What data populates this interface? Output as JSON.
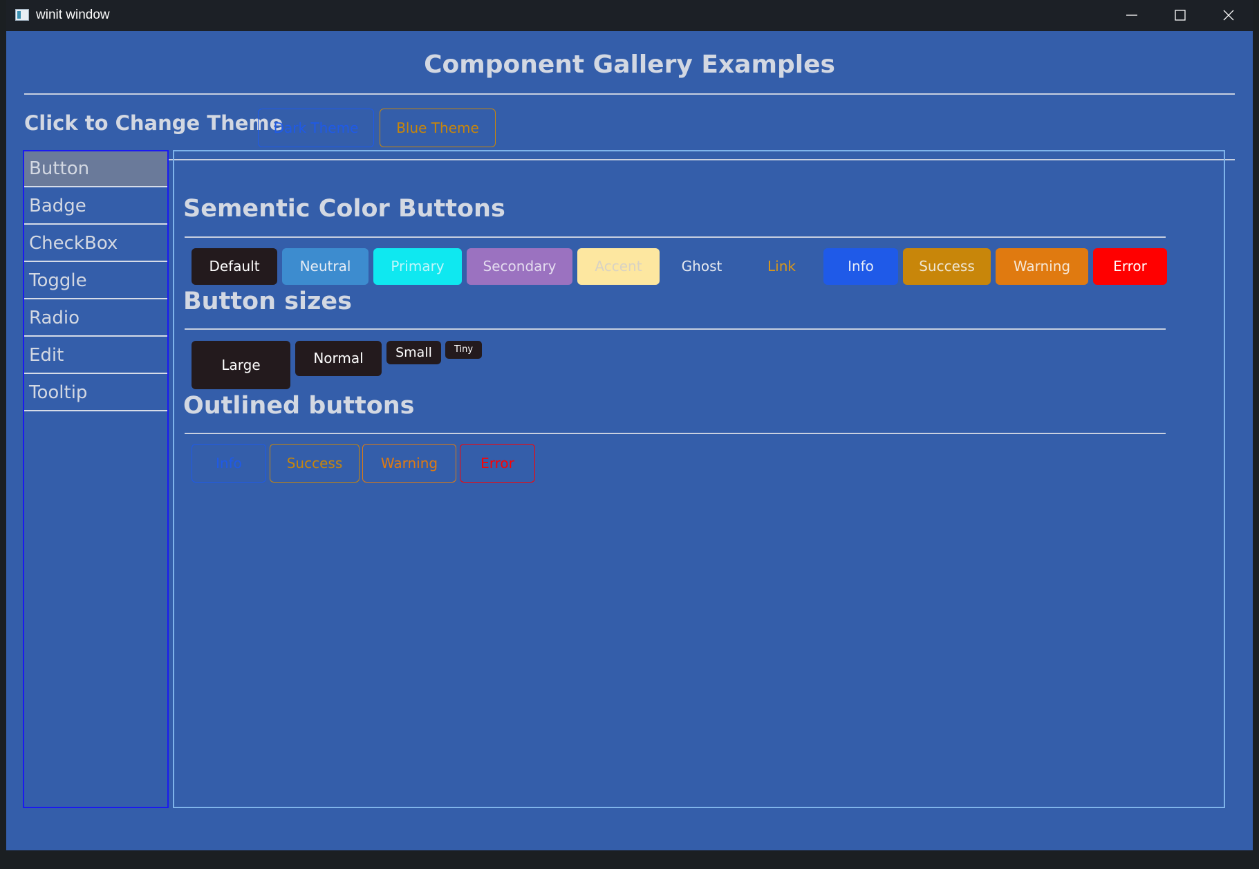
{
  "window": {
    "title": "winit window",
    "controls": {
      "minimize": "minimize",
      "maximize": "maximize",
      "close": "close"
    }
  },
  "app": {
    "title": "Component Gallery Examples",
    "theme_label": "Click to Change Theme",
    "theme_buttons": [
      {
        "label": "Dark Theme",
        "color": "#1f5ae8"
      },
      {
        "label": "Blue Theme",
        "color": "#c8860a"
      }
    ]
  },
  "sidebar": {
    "items": [
      {
        "label": "Button",
        "active": true
      },
      {
        "label": "Badge"
      },
      {
        "label": "CheckBox"
      },
      {
        "label": "Toggle"
      },
      {
        "label": "Radio"
      },
      {
        "label": "Edit"
      },
      {
        "label": "Tooltip"
      }
    ]
  },
  "sections": {
    "semantic": {
      "heading": "Sementic Color Buttons",
      "buttons": [
        {
          "label": "Default",
          "bg": "#231a1d",
          "fg": "#ffffff"
        },
        {
          "label": "Neutral",
          "bg": "#3d8ccf",
          "fg": "#e6ecf4"
        },
        {
          "label": "Primary",
          "bg": "#0fe8f0",
          "fg": "#bff6fa"
        },
        {
          "label": "Secondary",
          "bg": "#9b72c0",
          "fg": "#e4dcef"
        },
        {
          "label": "Accent",
          "bg": "#fde7a0",
          "fg": "#d8d2c4"
        },
        {
          "label": "Ghost",
          "bg": "transparent",
          "fg": "#e6e9ef"
        },
        {
          "label": "Link",
          "bg": "transparent",
          "fg": "#d9971a"
        },
        {
          "label": "Info",
          "bg": "#1f5ae8",
          "fg": "#e6ecf8"
        },
        {
          "label": "Success",
          "bg": "#c8860a",
          "fg": "#efe6d4"
        },
        {
          "label": "Warning",
          "bg": "#e07a10",
          "fg": "#f6e7d6"
        },
        {
          "label": "Error",
          "bg": "#ff0000",
          "fg": "#ffffff"
        }
      ]
    },
    "sizes": {
      "heading": "Button sizes",
      "buttons": [
        {
          "label": "Large"
        },
        {
          "label": "Normal"
        },
        {
          "label": "Small"
        },
        {
          "label": "Tiny"
        }
      ]
    },
    "outlined": {
      "heading": "Outlined buttons",
      "buttons": [
        {
          "label": "Info",
          "color": "#1f5ae8"
        },
        {
          "label": "Success",
          "color": "#c8860a"
        },
        {
          "label": "Warning",
          "color": "#e07a10"
        },
        {
          "label": "Error",
          "color": "#ff0000"
        }
      ]
    }
  }
}
